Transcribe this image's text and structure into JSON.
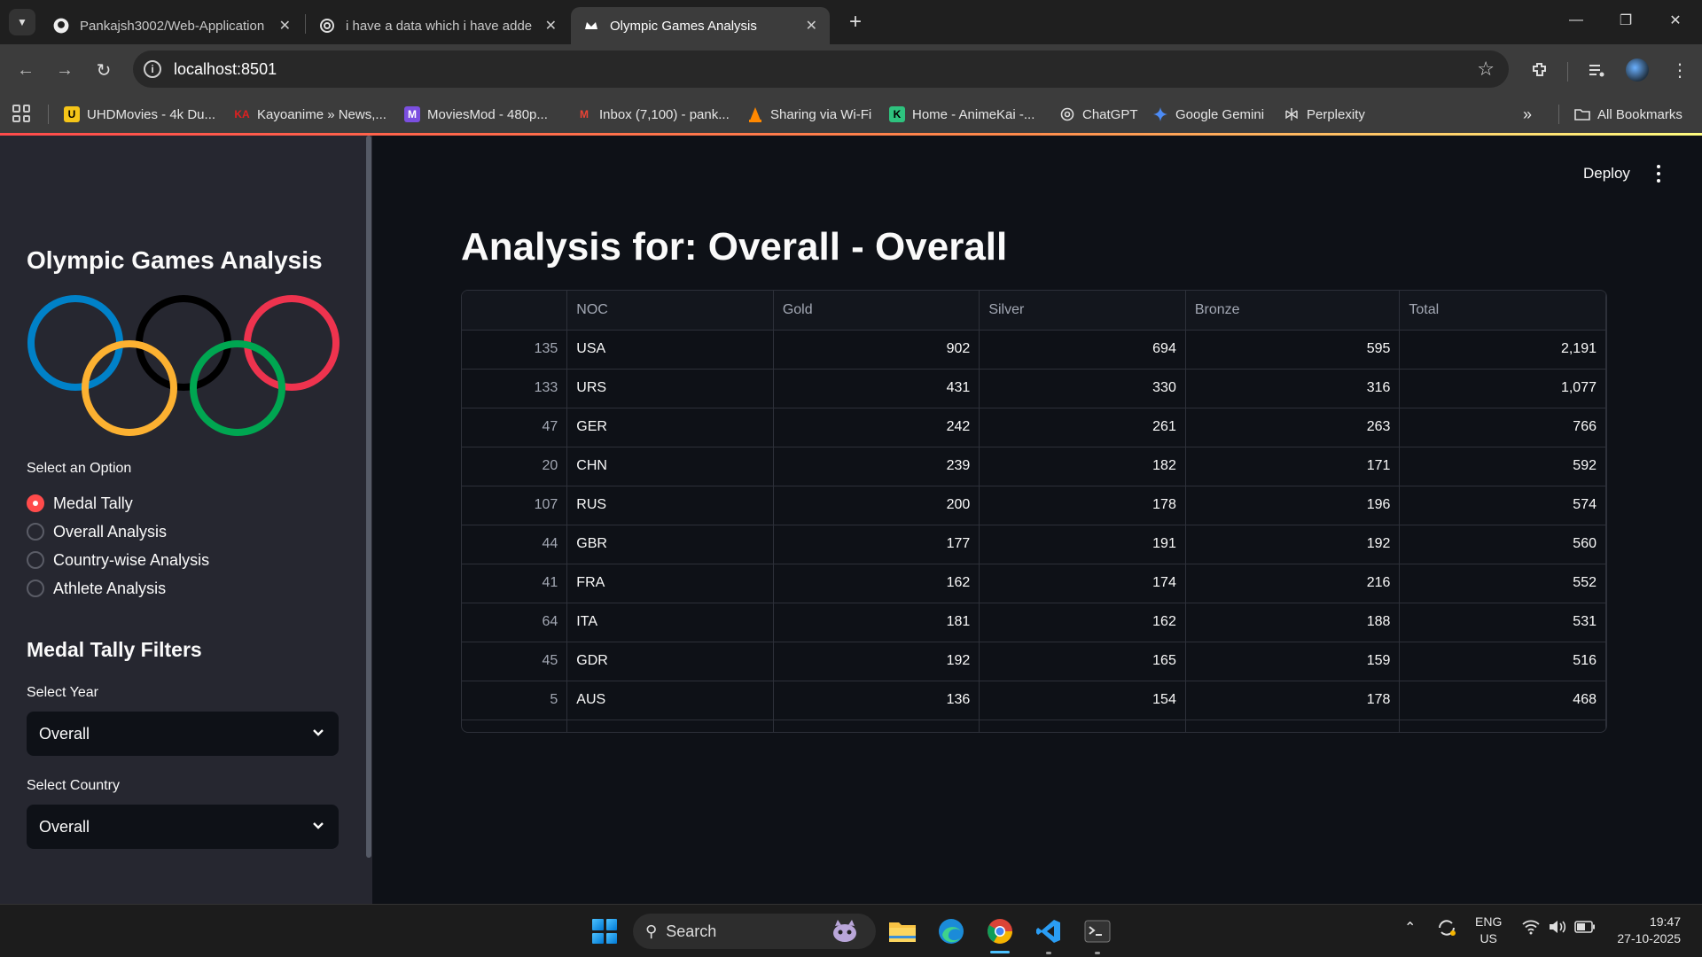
{
  "browser": {
    "tabs": [
      {
        "title": "Pankajsh3002/Web-Application",
        "active": false
      },
      {
        "title": "i have a data which i have adde",
        "active": false
      },
      {
        "title": "Olympic Games Analysis",
        "active": true
      }
    ],
    "url": "localhost:8501",
    "bookmarks": [
      {
        "label": "UHDMovies - 4k Du...",
        "icon": "uhd-icon",
        "color": "#f5c518"
      },
      {
        "label": "Kayoanime » News,...",
        "icon": "ka-icon",
        "color": "#e02020"
      },
      {
        "label": "MoviesMod - 480p...",
        "icon": "moviesmod-icon",
        "color": "#7b4fe0"
      },
      {
        "label": "Inbox (7,100) - pank...",
        "icon": "gmail-icon",
        "color": "#ea4335"
      },
      {
        "label": "Sharing via Wi-Fi",
        "icon": "vlc-icon",
        "color": "#ff8800"
      },
      {
        "label": "Home - AnimeKai -...",
        "icon": "animekai-icon",
        "color": "#2ec27e"
      },
      {
        "label": "ChatGPT",
        "icon": "chatgpt-icon",
        "color": "#dddddd"
      },
      {
        "label": "Google Gemini",
        "icon": "gemini-icon",
        "color": "#4c8bf5"
      },
      {
        "label": "Perplexity",
        "icon": "perplexity-icon",
        "color": "#dddddd"
      }
    ],
    "all_bookmarks": "All Bookmarks"
  },
  "app": {
    "sidebar": {
      "title": "Olympic Games Analysis",
      "select_option_label": "Select an Option",
      "options": [
        "Medal Tally",
        "Overall Analysis",
        "Country-wise Analysis",
        "Athlete Analysis"
      ],
      "selected_option": "Medal Tally",
      "filters_heading": "Medal Tally Filters",
      "year_label": "Select Year",
      "year_value": "Overall",
      "country_label": "Select Country",
      "country_value": "Overall",
      "ring_colors": [
        "#0081c8",
        "#fcb131",
        "#000000",
        "#00a651",
        "#ee334e"
      ]
    },
    "header": {
      "deploy": "Deploy"
    },
    "main": {
      "title": "Analysis for: Overall - Overall",
      "table": {
        "columns": [
          "",
          "NOC",
          "Gold",
          "Silver",
          "Bronze",
          "Total"
        ],
        "rows": [
          {
            "index": "135",
            "noc": "USA",
            "gold": "902",
            "silver": "694",
            "bronze": "595",
            "total": "2,191"
          },
          {
            "index": "133",
            "noc": "URS",
            "gold": "431",
            "silver": "330",
            "bronze": "316",
            "total": "1,077"
          },
          {
            "index": "47",
            "noc": "GER",
            "gold": "242",
            "silver": "261",
            "bronze": "263",
            "total": "766"
          },
          {
            "index": "20",
            "noc": "CHN",
            "gold": "239",
            "silver": "182",
            "bronze": "171",
            "total": "592"
          },
          {
            "index": "107",
            "noc": "RUS",
            "gold": "200",
            "silver": "178",
            "bronze": "196",
            "total": "574"
          },
          {
            "index": "44",
            "noc": "GBR",
            "gold": "177",
            "silver": "191",
            "bronze": "192",
            "total": "560"
          },
          {
            "index": "41",
            "noc": "FRA",
            "gold": "162",
            "silver": "174",
            "bronze": "216",
            "total": "552"
          },
          {
            "index": "64",
            "noc": "ITA",
            "gold": "181",
            "silver": "162",
            "bronze": "188",
            "total": "531"
          },
          {
            "index": "45",
            "noc": "GDR",
            "gold": "192",
            "silver": "165",
            "bronze": "159",
            "total": "516"
          },
          {
            "index": "5",
            "noc": "AUS",
            "gold": "136",
            "silver": "154",
            "bronze": "178",
            "total": "468"
          }
        ]
      }
    }
  },
  "taskbar": {
    "search_placeholder": "Search",
    "language": "ENG",
    "region": "US",
    "time": "19:47",
    "date": "27-10-2025"
  },
  "colors": {
    "accent": "#ff4b4b",
    "app_bg": "#0e1117",
    "sidebar_bg": "#262730"
  }
}
